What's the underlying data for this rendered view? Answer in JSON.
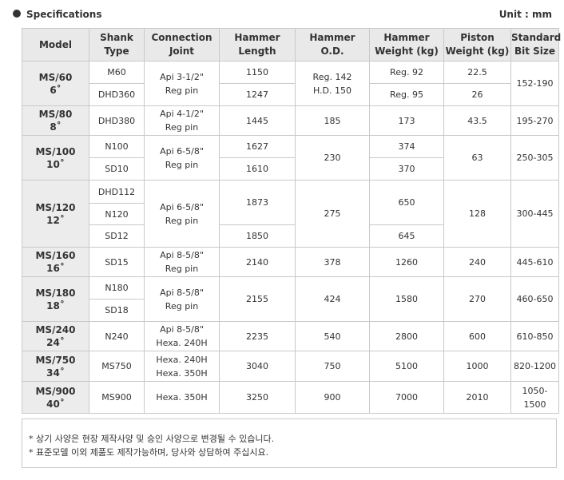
{
  "header": {
    "title": "Specifications",
    "unit": "Unit : mm"
  },
  "columns": {
    "model": "Model",
    "shank_1": "Shank",
    "shank_2": "Type",
    "conn_1": "Connection",
    "conn_2": "Joint",
    "hl_1": "Hammer",
    "hl_2": "Length",
    "hod_1": "Hammer",
    "hod_2": "O.D.",
    "hw_1": "Hammer",
    "hw_2": "Weight (kg)",
    "pw_1": "Piston",
    "pw_2": "Weight (kg)",
    "bit_1": "Standard",
    "bit_2": "Bit Size"
  },
  "rows": {
    "ms60": {
      "model_1": "MS/60",
      "model_2": "6˚",
      "shank_a": "M60",
      "shank_b": "DHD360",
      "conn_1": "Api 3-1/2\"",
      "conn_2": "Reg pin",
      "len_a": "1150",
      "len_b": "1247",
      "od_1": "Reg. 142",
      "od_2": "H.D. 150",
      "w_a": "Reg. 92",
      "w_b": "Reg. 95",
      "pw_a": "22.5",
      "pw_b": "26",
      "bit": "152-190"
    },
    "ms80": {
      "model_1": "MS/80",
      "model_2": "8˚",
      "shank": "DHD380",
      "conn_1": "Api 4-1/2\"",
      "conn_2": "Reg pin",
      "len": "1445",
      "od": "185",
      "w": "173",
      "pw": "43.5",
      "bit": "195-270"
    },
    "ms100": {
      "model_1": "MS/100",
      "model_2": "10˚",
      "shank_a": "N100",
      "shank_b": "SD10",
      "conn_1": "Api 6-5/8\"",
      "conn_2": "Reg pin",
      "len_a": "1627",
      "len_b": "1610",
      "od": "230",
      "w_a": "374",
      "w_b": "370",
      "pw": "63",
      "bit": "250-305"
    },
    "ms120": {
      "model_1": "MS/120",
      "model_2": "12˚",
      "shank_a": "DHD112",
      "shank_b": "N120",
      "shank_c": "SD12",
      "conn_1": "Api 6-5/8\"",
      "conn_2": "Reg pin",
      "len_a": "1873",
      "len_b": "1850",
      "od": "275",
      "w_a": "650",
      "w_b": "645",
      "pw": "128",
      "bit": "300-445"
    },
    "ms160": {
      "model_1": "MS/160",
      "model_2": "16˚",
      "shank": "SD15",
      "conn_1": "Api 8-5/8\"",
      "conn_2": "Reg pin",
      "len": "2140",
      "od": "378",
      "w": "1260",
      "pw": "240",
      "bit": "445-610"
    },
    "ms180": {
      "model_1": "MS/180",
      "model_2": "18˚",
      "shank_a": "N180",
      "shank_b": "SD18",
      "conn_1": "Api 8-5/8\"",
      "conn_2": "Reg pin",
      "len": "2155",
      "od": "424",
      "w": "1580",
      "pw": "270",
      "bit": "460-650"
    },
    "ms240": {
      "model_1": "MS/240",
      "model_2": "24˚",
      "shank": "N240",
      "conn_1": "Api 8-5/8\"",
      "conn_2": "Hexa. 240H",
      "len": "2235",
      "od": "540",
      "w": "2800",
      "pw": "600",
      "bit": "610-850"
    },
    "ms750": {
      "model_1": "MS/750",
      "model_2": "34˚",
      "shank": "MS750",
      "conn_1": "Hexa. 240H",
      "conn_2": "Hexa. 350H",
      "len": "3040",
      "od": "750",
      "w": "5100",
      "pw": "1000",
      "bit": "820-1200"
    },
    "ms900": {
      "model_1": "MS/900",
      "model_2": "40˚",
      "shank": "MS900",
      "conn": "Hexa. 350H",
      "len": "3250",
      "od": "900",
      "w": "7000",
      "pw": "2010",
      "bit": "1050-1500"
    }
  },
  "notes": [
    "* 상기 사양은 현장 제작사양 및 승인 사양으로 변경될 수 있습니다.",
    "* 표준모델 이외 제품도 제작가능하며, 당사와 상담하여 주십시요."
  ]
}
